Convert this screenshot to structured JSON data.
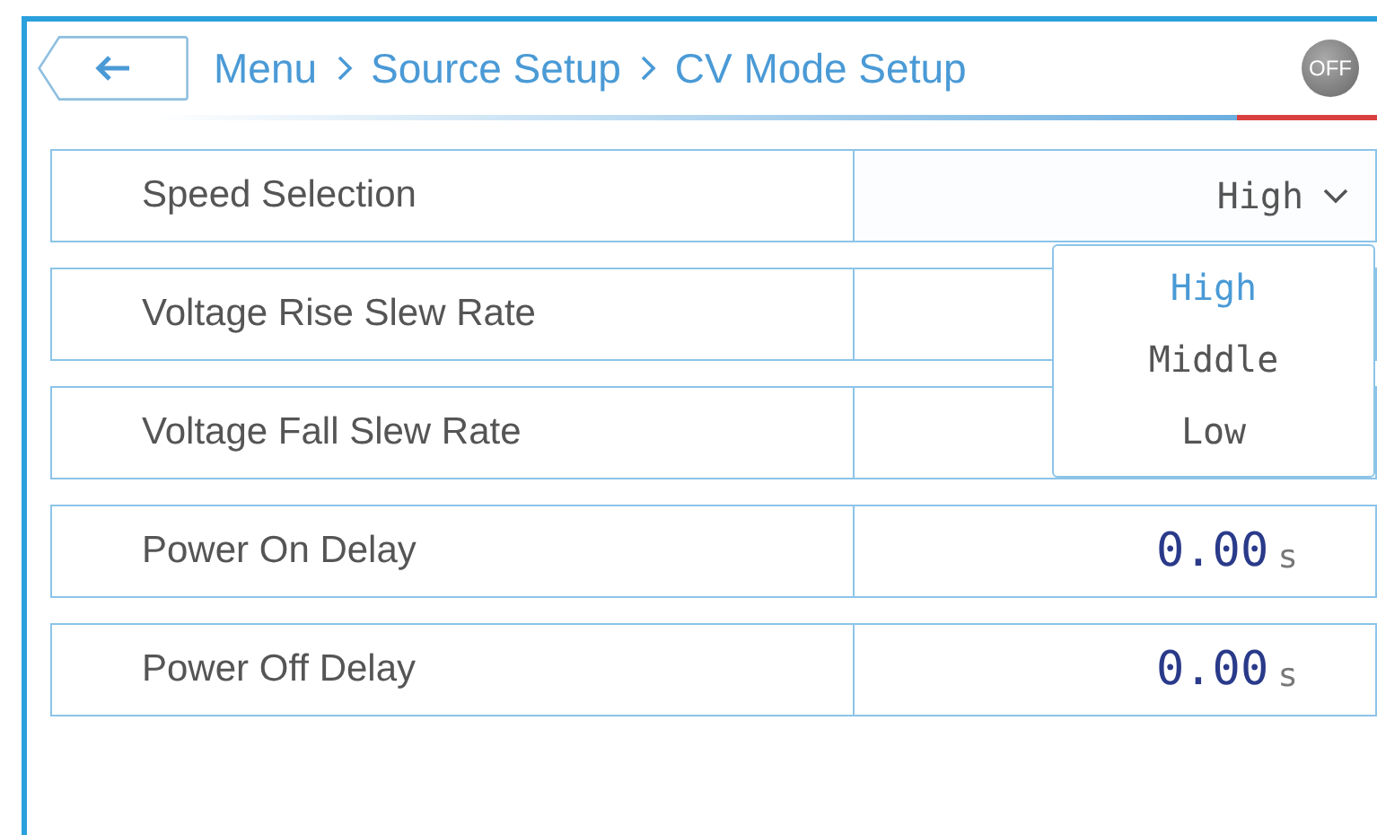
{
  "header": {
    "breadcrumb": [
      "Menu",
      "Source Setup",
      "CV Mode Setup"
    ],
    "output_badge": "OFF"
  },
  "rows": [
    {
      "label": "Speed Selection",
      "kind": "dropdown",
      "value": "High",
      "expanded": true,
      "options": [
        {
          "label": "High",
          "selected": true
        },
        {
          "label": "Middle",
          "selected": false
        },
        {
          "label": "Low",
          "selected": false
        }
      ]
    },
    {
      "label": "Voltage Rise Slew Rate",
      "kind": "value"
    },
    {
      "label": "Voltage Fall Slew Rate",
      "kind": "value"
    },
    {
      "label": "Power On Delay",
      "kind": "value",
      "value": "0.00",
      "unit": "s"
    },
    {
      "label": "Power Off Delay",
      "kind": "value",
      "value": "0.00",
      "unit": "s"
    }
  ]
}
